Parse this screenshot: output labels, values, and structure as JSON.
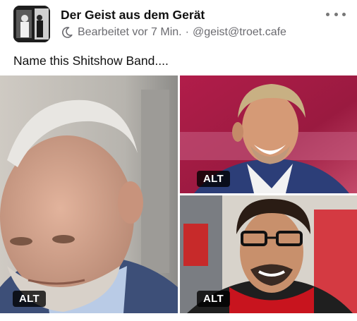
{
  "post": {
    "author": "Der Geist aus dem Gerät",
    "edited": "Bearbeitet vor 7 Min.",
    "separator": "·",
    "handle": "@geist@troet.cafe",
    "text": "Name this Shitshow Band...."
  },
  "icons": {
    "visibility": "moon-icon",
    "menu": "more-options-icon"
  },
  "media": [
    {
      "alt_label": "ALT"
    },
    {
      "alt_label": "ALT"
    },
    {
      "alt_label": "ALT"
    }
  ],
  "colors": {
    "text": "#111111",
    "meta": "#6b6b70",
    "alt_badge": "#000000"
  }
}
